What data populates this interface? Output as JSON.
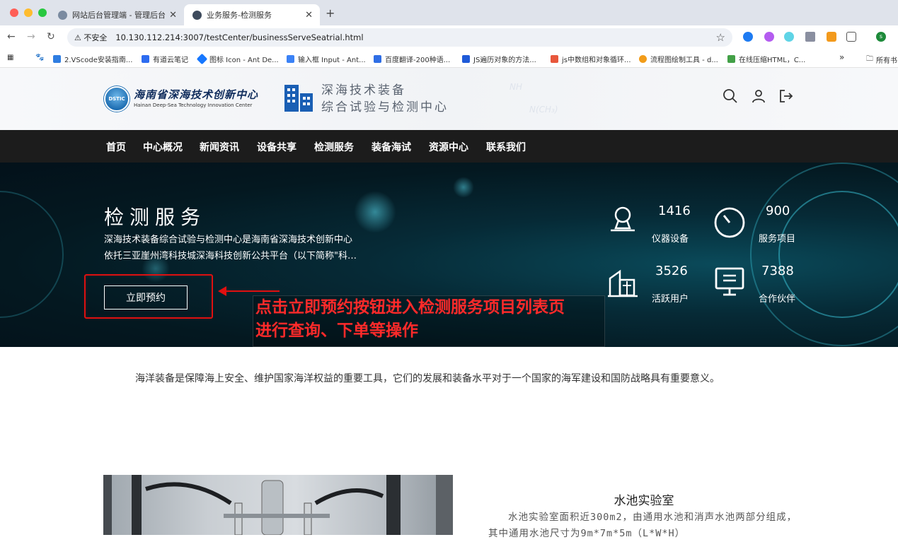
{
  "browser": {
    "tabs": [
      {
        "title": "网站后台管理端 - 管理后台",
        "active": false
      },
      {
        "title": "业务服务-检测服务",
        "active": true
      }
    ],
    "security_label": "不安全",
    "url": "10.130.112.214:3007/testCenter/businessServeSeatrial.html",
    "bookmarks": [
      "2.VScode安装指南...",
      "有道云笔记",
      "图标 Icon - Ant De...",
      "输入框 Input - Ant...",
      "百度翻译-200种语...",
      "JS遍历对象的方法...",
      "js中数组和对象循环...",
      "流程图绘制工具 - d...",
      "在线压缩HTML，C..."
    ],
    "bookmarks_overflow": "»",
    "all_bookmarks": "所有书"
  },
  "header": {
    "org_cn": "海南省深海技术创新中心",
    "org_en": "Hainan Deep-Sea Technology Innovation Center",
    "logo_text": "DSTIC",
    "center_line1": "深海技术装备",
    "center_line2": "综合试验与检测中心",
    "chem1": "NH",
    "chem2": "N(CH₃)"
  },
  "nav": [
    "首页",
    "中心概况",
    "新闻资讯",
    "设备共享",
    "检测服务",
    "装备海试",
    "资源中心",
    "联系我们"
  ],
  "banner": {
    "title": "检测服务",
    "desc_line1": "深海技术装备综合试验与检测中心是海南省深海技术创新中心",
    "desc_line2": "依托三亚崖州湾科技城深海科技创新公共平台（以下简称\"科…",
    "button": "立即预约",
    "annotation_line1": "点击立即预约按钮进入检测服务项目列表页",
    "annotation_line2": "进行查询、下单等操作",
    "stats": [
      {
        "number": "1416",
        "label": "仪器设备",
        "icon": "person-icon"
      },
      {
        "number": "900",
        "label": "服务项目",
        "icon": "gauge-icon"
      },
      {
        "number": "3526",
        "label": "活跃用户",
        "icon": "building-icon"
      },
      {
        "number": "7388",
        "label": "合作伙伴",
        "icon": "monitor-icon"
      }
    ]
  },
  "intro": "海洋装备是保障海上安全、维护国家海洋权益的重要工具，它们的发展和装备水平对于一个国家的海军建设和国防战略具有重要意义。",
  "lab": {
    "title": "水池实验室",
    "desc": "水池实验室面积近300m2，由通用水池和消声水池两部分组成，其中通用水池尺寸为9m*7m*5m（L*W*H）"
  },
  "colors": {
    "annotation_red": "#e01010",
    "nav_bg": "#1c1c1c",
    "banner_bg": "#041820"
  }
}
